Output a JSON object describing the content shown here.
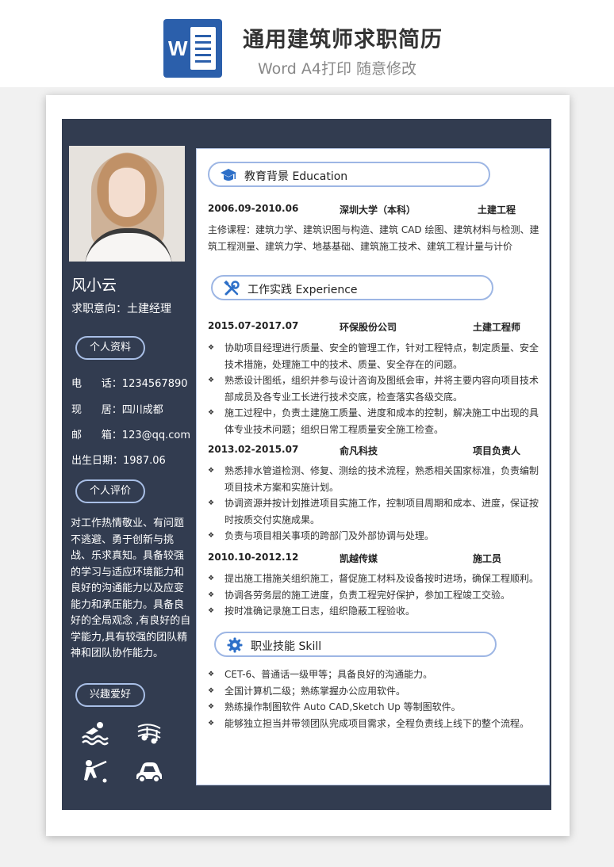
{
  "header": {
    "app_icon": "word-icon",
    "title": "通用建筑师求职简历",
    "subtitle": "Word A4打印 随意修改"
  },
  "profile": {
    "name": "风小云",
    "objective": "求职意向：土建经理"
  },
  "sidebar": {
    "personal_label": "个人资料",
    "contact": {
      "phone": "电      话：1234567890",
      "residence": "现      居：四川成都",
      "email": "邮      箱：123@qq.com",
      "birthday": "出生日期：1987.06"
    },
    "evaluation_label": "个人评价",
    "evaluation_text": "对工作热情敬业、有问题不逃避、勇于创新与挑战、乐求真知。具备较强的学习与适应环境能力和良好的沟通能力以及应变能力和承压能力。具备良好的全局观念 ,有良好的自学能力,具有较强的团队精神和团队协作能力。",
    "hobby_label": "兴趣爱好",
    "hobbies": [
      "swimming-icon",
      "music-icon",
      "golf-icon",
      "car-icon"
    ]
  },
  "education": {
    "heading": "教育背景  Education",
    "icon": "graduation-cap-icon",
    "period": "2006.09-2010.06",
    "school": "深圳大学（本科）",
    "major": "土建工程",
    "courses": "主修课程：建筑力学、建筑识图与构造、建筑 CAD 绘图、建筑材料与检测、建筑工程测量、建筑力学、地基基础、建筑施工技术、建筑工程计量与计价"
  },
  "experience": {
    "heading": "工作实践  Experience",
    "icon": "tools-icon",
    "jobs": [
      {
        "period": "2015.07-2017.07",
        "company": "环保股份公司",
        "role": "土建工程师",
        "bullets": [
          "协助项目经理进行质量、安全的管理工作，针对工程特点，制定质量、安全技术措施，处理施工中的技术、质量、安全存在的问题。",
          "熟悉设计图纸，组织并参与设计咨询及图纸会审，并将主要内容向项目技术部成员及各专业工长进行技术交底，检查落实各级交底。",
          "施工过程中，负责土建施工质量、进度和成本的控制，解决施工中出现的具体专业技术问题；组织日常工程质量安全施工检查。"
        ]
      },
      {
        "period": "2013.02-2015.07",
        "company": "俞凡科技",
        "role": "项目负责人",
        "bullets": [
          "熟悉排水管道检测、修复、测绘的技术流程，熟悉相关国家标准，负责编制项目技术方案和实施计划。",
          "协调资源并按计划推进项目实施工作，控制项目周期和成本、进度，保证按时按质交付实施成果。",
          "负责与项目相关事项的跨部门及外部协调与处理。"
        ]
      },
      {
        "period": "2010.10-2012.12",
        "company": "凯越传媒",
        "role": "施工员",
        "bullets": [
          "提出施工措施关组织施工，督促施工材料及设备按时进场，确保工程顺利。",
          "协调各劳务层的施工进度，负责工程完好保护，参加工程竣工交验。",
          "按时准确记录施工日志，组织隐蔽工程验收。"
        ]
      }
    ]
  },
  "skills": {
    "heading": "职业技能  Skill",
    "icon": "gear-icon",
    "items": [
      "CET-6、普通话一级甲等；具备良好的沟通能力。",
      "全国计算机二级；熟练掌握办公应用软件。",
      "熟练操作制图软件 Auto CAD,Sketch Up 等制图软件。",
      "能够独立担当并带领团队完成项目需求，全程负责线上线下的整个流程。"
    ]
  },
  "colors": {
    "sidebar_bg": "#323c50",
    "pill_border": "#9db6e4",
    "icon_blue": "#2d6fc8",
    "word_blue": "#2b5fab"
  }
}
